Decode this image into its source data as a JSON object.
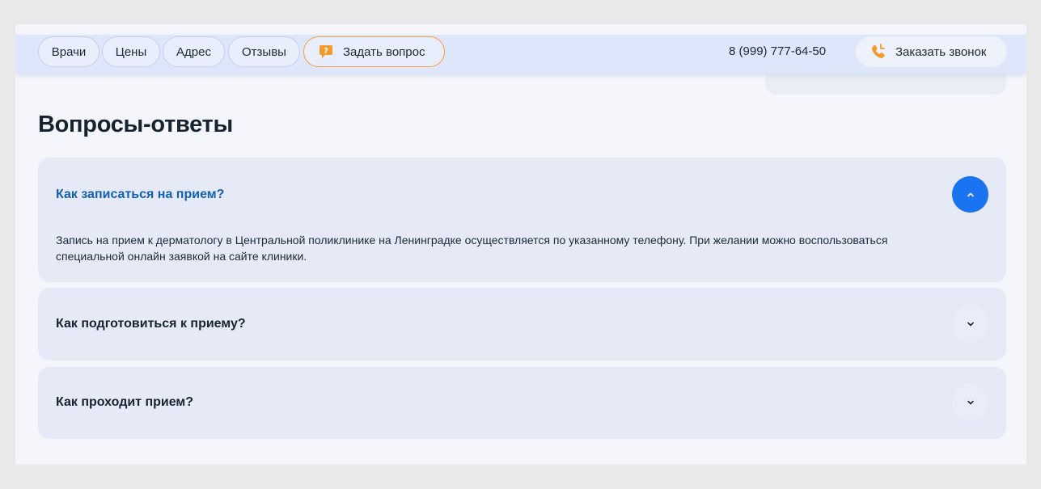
{
  "nav": {
    "items": [
      "Врачи",
      "Цены",
      "Адрес",
      "Отзывы"
    ],
    "ask_label": "Задать вопрос",
    "phone": "8 (999) 777-64-50",
    "callback_label": "Заказать звонок"
  },
  "faq": {
    "title": "Вопросы-ответы",
    "items": [
      {
        "question": "Как записаться на прием?",
        "answer": "Запись на прием к дерматологу в Центральной поликлинике на Ленинградке осуществляется по указанному телефону. При желании можно воспользоваться специальной онлайн заявкой на сайте клиники.",
        "expanded": true
      },
      {
        "question": "Как подготовиться к приему?",
        "expanded": false
      },
      {
        "question": "Как проходит прием?",
        "expanded": false
      }
    ]
  },
  "icons": {
    "ask": "chat-question-icon",
    "callback": "phone-call-icon",
    "toggle_open": "chevron-up-icon",
    "toggle_closed": "chevron-down-icon"
  },
  "colors": {
    "accent_blue": "#1a73f0",
    "active_question": "#1260b3",
    "orange": "#f1a13f"
  }
}
